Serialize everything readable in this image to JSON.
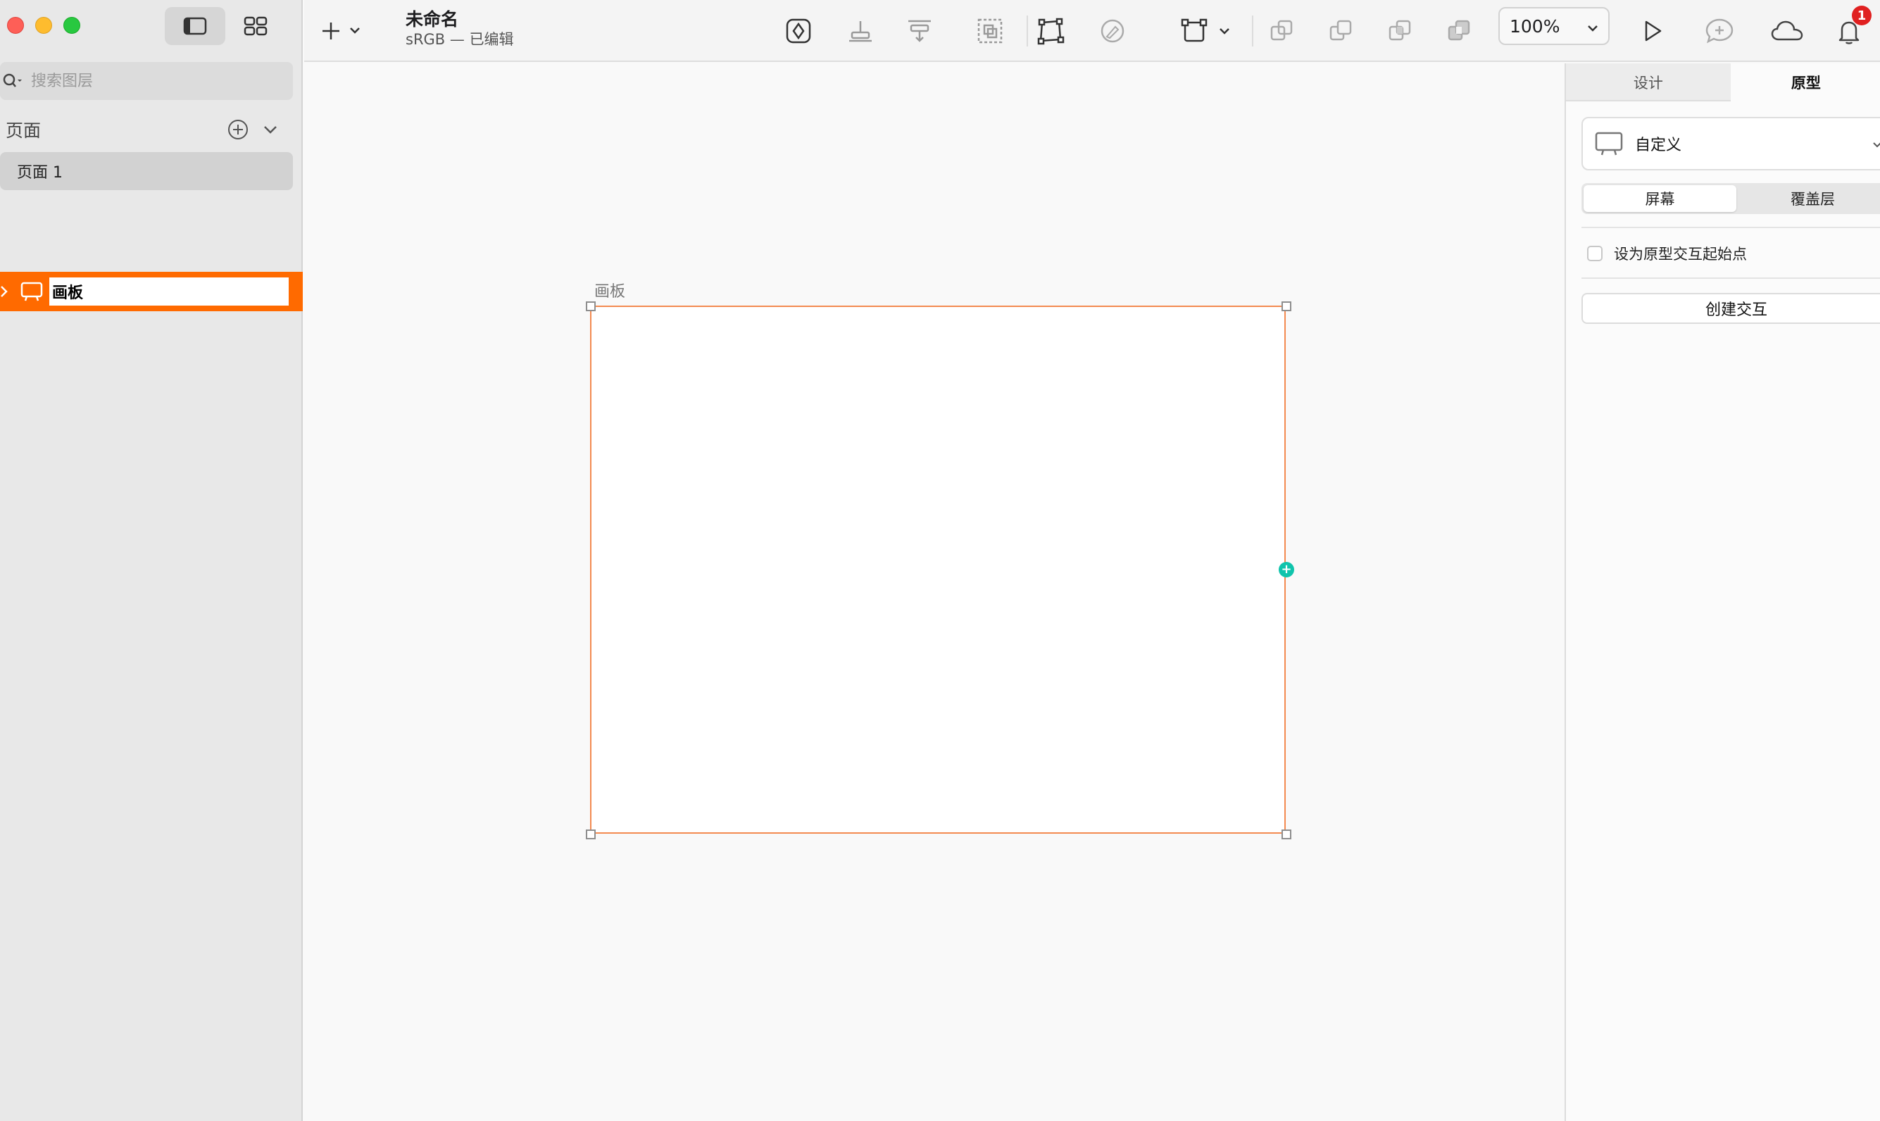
{
  "app": {
    "document_title": "未命名",
    "document_subtitle": "sRGB — 已编辑"
  },
  "sidebar": {
    "search_placeholder": "搜索图层",
    "pages_title": "页面",
    "pages": [
      {
        "label": "页面 1"
      }
    ],
    "layers": [
      {
        "label": "画板",
        "selected": true
      }
    ]
  },
  "toolbar": {
    "zoom": "100%",
    "notification_count": "1",
    "icons": [
      "plus-icon",
      "symbol-icon",
      "align-bottom-icon",
      "distribute-icon",
      "mask-icon",
      "transform-icon",
      "pen-disabled-icon",
      "resize-icon",
      "union-icon",
      "subtract-icon",
      "intersect-icon",
      "difference-icon",
      "play-icon",
      "comment-icon",
      "cloud-icon",
      "bell-icon"
    ]
  },
  "canvas": {
    "artboard_label": "画板"
  },
  "inspector": {
    "tabs": [
      {
        "label": "设计"
      },
      {
        "label": "原型"
      }
    ],
    "active_tab": "原型",
    "device": "自定义",
    "segments": [
      {
        "label": "屏幕"
      },
      {
        "label": "覆盖层"
      }
    ],
    "start_point_label": "设为原型交互起始点",
    "create_button": "创建交互"
  },
  "colors": {
    "accent": "#ff6a00",
    "artboard_border": "#f38a50",
    "connection_handle": "#10c4ac",
    "badge": "#e02020"
  }
}
